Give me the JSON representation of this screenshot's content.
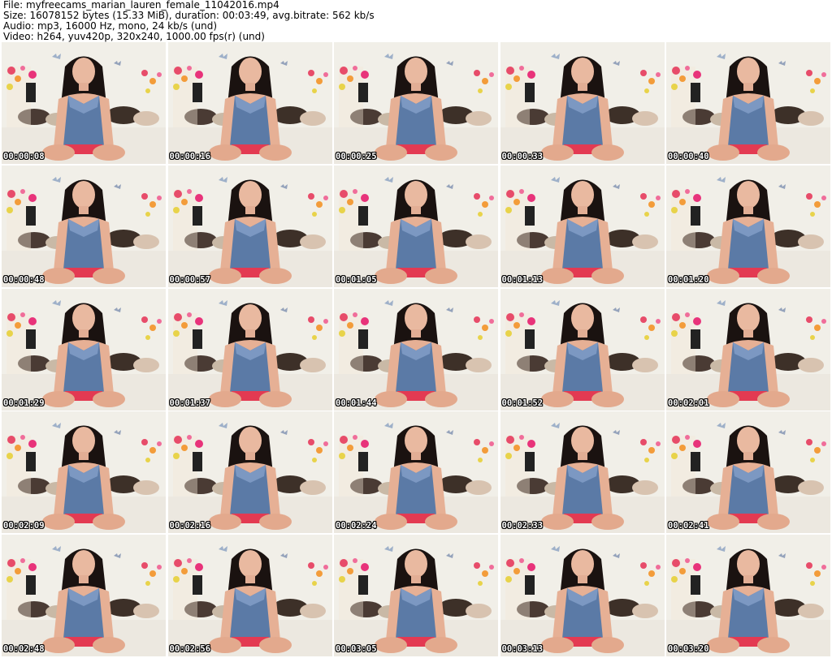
{
  "header": {
    "file": "File: myfreecams_marian_lauren_female_11042016.mp4",
    "size": "Size: 16078152 bytes (15.33 MiB), duration: 00:03:49, avg.bitrate: 562 kb/s",
    "audio": "Audio: mp3, 16000 Hz, mono, 24 kb/s (und)",
    "video": "Video: h264, yuv420p, 320x240, 1000.00 fps(r) (und)"
  },
  "thumbnails": [
    {
      "timestamp": "00:00:08"
    },
    {
      "timestamp": "00:00:16"
    },
    {
      "timestamp": "00:00:25"
    },
    {
      "timestamp": "00:00:33"
    },
    {
      "timestamp": "00:00:40"
    },
    {
      "timestamp": "00:00:48"
    },
    {
      "timestamp": "00:00:57"
    },
    {
      "timestamp": "00:01:05"
    },
    {
      "timestamp": "00:01:13"
    },
    {
      "timestamp": "00:01:20"
    },
    {
      "timestamp": "00:01:29"
    },
    {
      "timestamp": "00:01:37"
    },
    {
      "timestamp": "00:01:44"
    },
    {
      "timestamp": "00:01:52"
    },
    {
      "timestamp": "00:02:01"
    },
    {
      "timestamp": "00:02:09"
    },
    {
      "timestamp": "00:02:16"
    },
    {
      "timestamp": "00:02:24"
    },
    {
      "timestamp": "00:02:33"
    },
    {
      "timestamp": "00:02:41"
    },
    {
      "timestamp": "00:02:48"
    },
    {
      "timestamp": "00:02:56"
    },
    {
      "timestamp": "00:03:05"
    },
    {
      "timestamp": "00:03:13"
    },
    {
      "timestamp": "00:03:20"
    }
  ]
}
